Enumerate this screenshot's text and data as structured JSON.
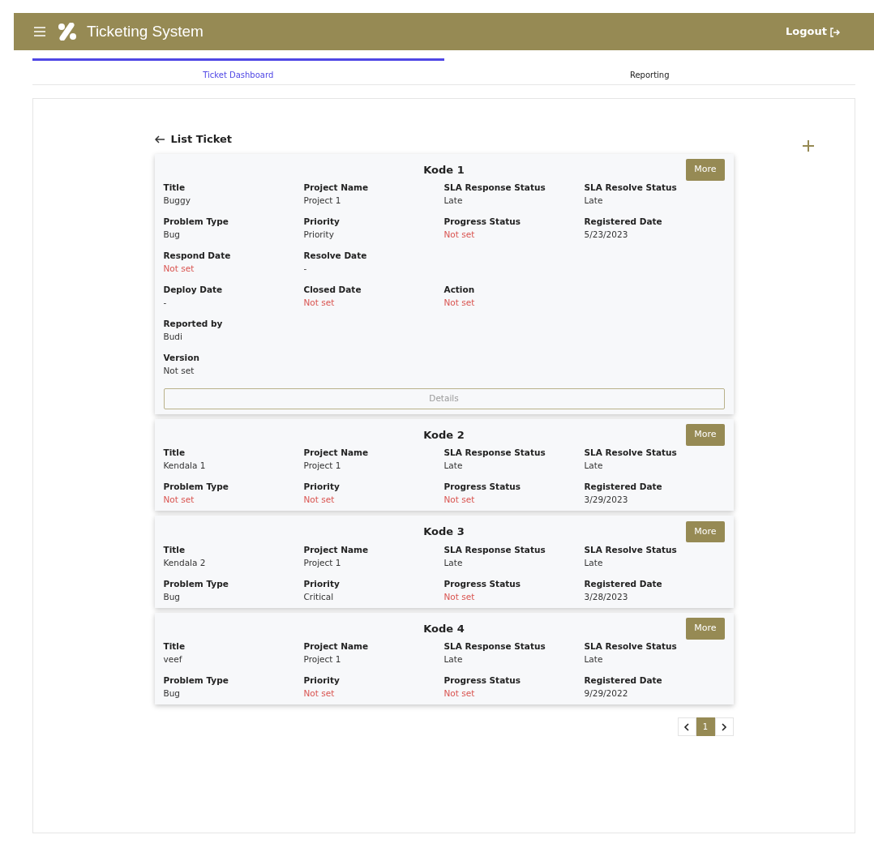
{
  "header": {
    "title": "Ticketing System",
    "logout": "Logout"
  },
  "tabs": [
    {
      "label": "Ticket Dashboard",
      "selected": true
    },
    {
      "label": "Reporting",
      "selected": false
    }
  ],
  "page_title": "List Ticket",
  "tickets": [
    {
      "code": "Kode 1",
      "more": "More",
      "details": "Details",
      "rows": [
        [
          {
            "label": "Title",
            "value": "Buggy",
            "unset": false
          },
          {
            "label": "Project Name",
            "value": "Project 1",
            "unset": false
          },
          {
            "label": "SLA Response Status",
            "value": "Late",
            "unset": false
          },
          {
            "label": "SLA Resolve Status",
            "value": "Late",
            "unset": false
          }
        ],
        [
          {
            "label": "Problem Type",
            "value": "Bug",
            "unset": false
          },
          {
            "label": "Priority",
            "value": "Priority",
            "unset": false
          },
          {
            "label": "Progress Status",
            "value": "Not set",
            "unset": true
          },
          {
            "label": "Registered Date",
            "value": "5/23/2023",
            "unset": false
          }
        ],
        [
          {
            "label": "Respond Date",
            "value": "Not set",
            "unset": true
          },
          {
            "label": "Resolve Date",
            "value": "-",
            "unset": false
          }
        ],
        [
          {
            "label": "Deploy Date",
            "value": "-",
            "unset": false
          },
          {
            "label": "Closed Date",
            "value": "Not set",
            "unset": true
          },
          {
            "label": "Action",
            "value": "Not set",
            "unset": true
          }
        ],
        [
          {
            "label": "Reported by",
            "value": "Budi",
            "unset": false
          }
        ],
        [
          {
            "label": "Version",
            "value": "Not set",
            "unset": false
          }
        ]
      ]
    },
    {
      "code": "Kode 2",
      "more": "More",
      "rows": [
        [
          {
            "label": "Title",
            "value": "Kendala 1",
            "unset": false
          },
          {
            "label": "Project Name",
            "value": "Project 1",
            "unset": false
          },
          {
            "label": "SLA Response Status",
            "value": "Late",
            "unset": false
          },
          {
            "label": "SLA Resolve Status",
            "value": "Late",
            "unset": false
          }
        ],
        [
          {
            "label": "Problem Type",
            "value": "Not set",
            "unset": true
          },
          {
            "label": "Priority",
            "value": "Not set",
            "unset": true
          },
          {
            "label": "Progress Status",
            "value": "Not set",
            "unset": true
          },
          {
            "label": "Registered Date",
            "value": "3/29/2023",
            "unset": false
          }
        ]
      ]
    },
    {
      "code": "Kode 3",
      "more": "More",
      "rows": [
        [
          {
            "label": "Title",
            "value": "Kendala 2",
            "unset": false
          },
          {
            "label": "Project Name",
            "value": "Project 1",
            "unset": false
          },
          {
            "label": "SLA Response Status",
            "value": "Late",
            "unset": false
          },
          {
            "label": "SLA Resolve Status",
            "value": "Late",
            "unset": false
          }
        ],
        [
          {
            "label": "Problem Type",
            "value": "Bug",
            "unset": false
          },
          {
            "label": "Priority",
            "value": "Critical",
            "unset": false
          },
          {
            "label": "Progress Status",
            "value": "Not set",
            "unset": true
          },
          {
            "label": "Registered Date",
            "value": "3/28/2023",
            "unset": false
          }
        ]
      ]
    },
    {
      "code": "Kode 4",
      "more": "More",
      "rows": [
        [
          {
            "label": "Title",
            "value": "veef",
            "unset": false
          },
          {
            "label": "Project Name",
            "value": "Project 1",
            "unset": false
          },
          {
            "label": "SLA Response Status",
            "value": "Late",
            "unset": false
          },
          {
            "label": "SLA Resolve Status",
            "value": "Late",
            "unset": false
          }
        ],
        [
          {
            "label": "Problem Type",
            "value": "Bug",
            "unset": false
          },
          {
            "label": "Priority",
            "value": "Not set",
            "unset": true
          },
          {
            "label": "Progress Status",
            "value": "Not set",
            "unset": true
          },
          {
            "label": "Registered Date",
            "value": "9/29/2022",
            "unset": false
          }
        ]
      ]
    }
  ],
  "pagination": [
    {
      "label": "1",
      "selected": true
    }
  ]
}
